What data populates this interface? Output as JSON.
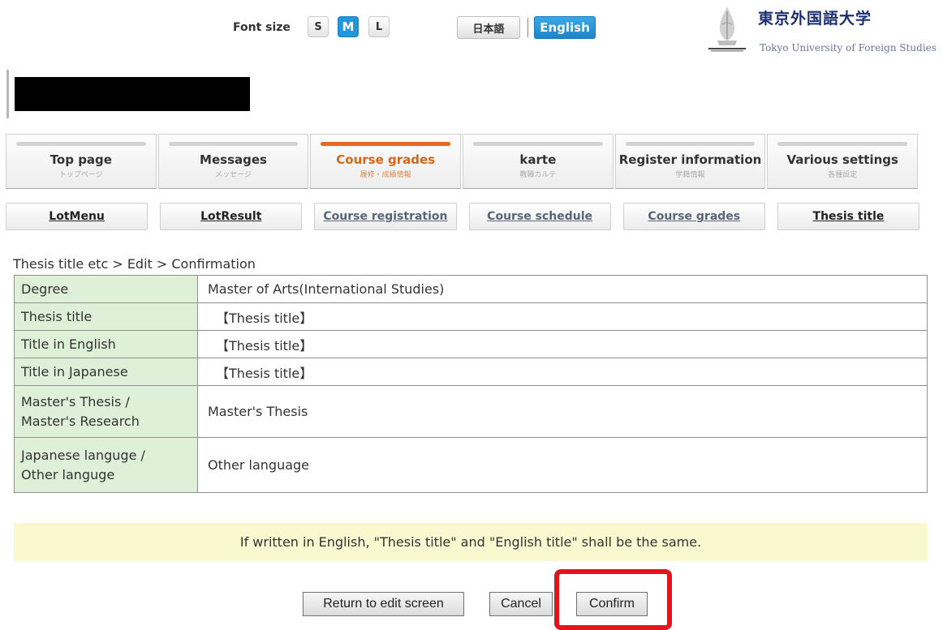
{
  "header": {
    "font_size_label": "Font size",
    "font_sizes": [
      "S",
      "M",
      "L"
    ],
    "lang_japanese": "日本語",
    "lang_english": "English"
  },
  "logo": {
    "name_jp": "東京外国語大学",
    "name_en": "Tokyo University of Foreign Studies"
  },
  "main_nav": [
    {
      "label": "Top page",
      "sub": "トップページ",
      "active": false
    },
    {
      "label": "Messages",
      "sub": "メッセージ",
      "active": false
    },
    {
      "label": "Course grades",
      "sub": "履修・成績情報",
      "active": true
    },
    {
      "label": "karte",
      "sub": "教職カルテ",
      "active": false
    },
    {
      "label": "Register information",
      "sub": "学籍情報",
      "active": false
    },
    {
      "label": "Various settings",
      "sub": "各種設定",
      "active": false
    }
  ],
  "sub_nav": [
    "LotMenu",
    "LotResult",
    "Course registration",
    "Course schedule",
    "Course grades",
    "Thesis title"
  ],
  "breadcrumb": "Thesis title etc > Edit > Confirmation",
  "table": {
    "degree_label": "Degree",
    "degree_value": "Master of Arts(International Studies)",
    "thesis_title_label": "Thesis title",
    "thesis_title_value": "【Thesis title】",
    "title_english_label": "Title in English",
    "title_english_value": "【Thesis title】",
    "title_japanese_label": "Title in Japanese",
    "title_japanese_value": "【Thesis title】",
    "thesis_type_label_1": "Master's Thesis /",
    "thesis_type_label_2": "Master's Research",
    "thesis_type_value": "Master's Thesis",
    "language_label_1": "Japanese languge /",
    "language_label_2": "Other languge",
    "language_value": "Other language"
  },
  "note": "If written in English, \"Thesis title\" and \"English title\" shall be the same.",
  "buttons": {
    "return": "Return to edit screen",
    "cancel": "Cancel",
    "confirm": "Confirm"
  },
  "colors": {
    "accent_blue": "#2196d8",
    "active_tab_orange": "#e8691f",
    "label_green": "#dff0d8",
    "note_yellow": "#fbf8d0",
    "highlight_red": "#e3141e"
  }
}
